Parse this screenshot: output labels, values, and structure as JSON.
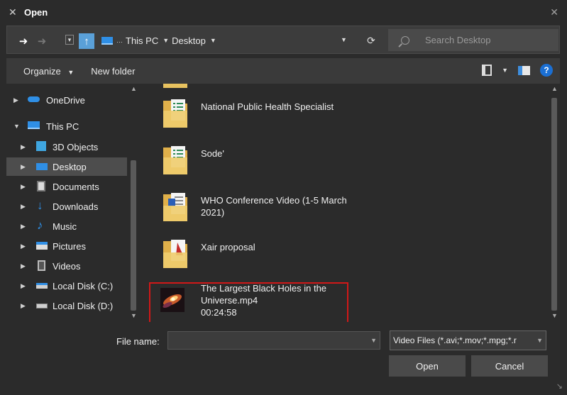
{
  "window": {
    "title": "Open",
    "title_icon": "app-x-icon"
  },
  "address": {
    "crumbs": [
      "This PC",
      "Desktop"
    ],
    "search_placeholder": "Search Desktop"
  },
  "toolbar": {
    "organize": "Organize",
    "new_folder": "New folder"
  },
  "nav": {
    "items": [
      {
        "label": "OneDrive",
        "icon": "onedrive-icon"
      },
      {
        "label": "This PC",
        "icon": "pc-icon"
      },
      {
        "label": "3D Objects",
        "icon": "3d-objects-icon"
      },
      {
        "label": "Desktop",
        "icon": "desktop-icon"
      },
      {
        "label": "Documents",
        "icon": "documents-icon"
      },
      {
        "label": "Downloads",
        "icon": "downloads-icon"
      },
      {
        "label": "Music",
        "icon": "music-icon"
      },
      {
        "label": "Pictures",
        "icon": "pictures-icon"
      },
      {
        "label": "Videos",
        "icon": "videos-icon"
      },
      {
        "label": "Local Disk (C:)",
        "icon": "drive-c-icon"
      },
      {
        "label": "Local Disk (D:)",
        "icon": "drive-d-icon"
      }
    ]
  },
  "files": [
    {
      "name": "National Public Health Specialist",
      "icon": "folder-excel-icon"
    },
    {
      "name": "Sode'",
      "icon": "folder-excel-icon"
    },
    {
      "name": "WHO Conference Video (1-5 March 2021)",
      "icon": "folder-word-icon"
    },
    {
      "name": "Xair proposal",
      "icon": "folder-pdf-icon"
    },
    {
      "name": "The Largest Black Holes in the Universe.mp4",
      "duration": "00:24:58",
      "icon": "video-thumbnail-icon"
    }
  ],
  "footer": {
    "file_name_label": "File name:",
    "file_name_value": "",
    "file_type": "Video Files (*.avi;*.mov;*.mpg;*.r",
    "open": "Open",
    "cancel": "Cancel"
  },
  "colors": {
    "highlight": "#d11818",
    "accent": "#1b6fd3",
    "selected": "#4d4d4d"
  }
}
